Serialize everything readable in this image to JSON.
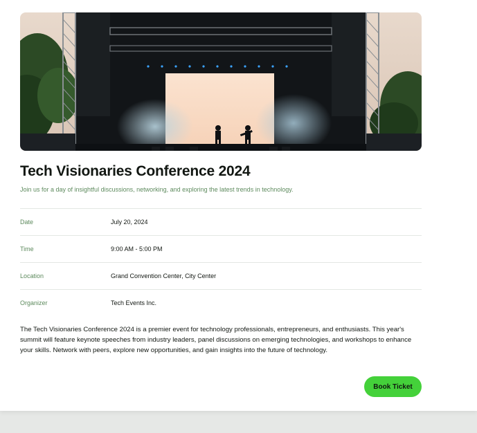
{
  "event": {
    "title": "Tech Visionaries Conference 2024",
    "subtitle": "Join us for a day of insightful discussions, networking, and exploring the latest trends in technology.",
    "details": [
      {
        "label": "Date",
        "value": "July 20, 2024"
      },
      {
        "label": "Time",
        "value": "9:00 AM - 5:00 PM"
      },
      {
        "label": "Location",
        "value": "Grand Convention Center, City Center"
      },
      {
        "label": "Organizer",
        "value": "Tech Events Inc."
      }
    ],
    "description": "The Tech Visionaries Conference 2024 is a premier event for technology professionals, entrepreneurs, and enthusiasts. This year's summit will feature keynote speeches from industry leaders, panel discussions on emerging technologies, and workshops to enhance your skills. Network with peers, explore new opportunities, and gain insights into the future of technology.",
    "book_label": "Book Ticket"
  },
  "colors": {
    "accent": "#44d13a",
    "label_green": "#5d8a5d",
    "text": "#121712"
  }
}
